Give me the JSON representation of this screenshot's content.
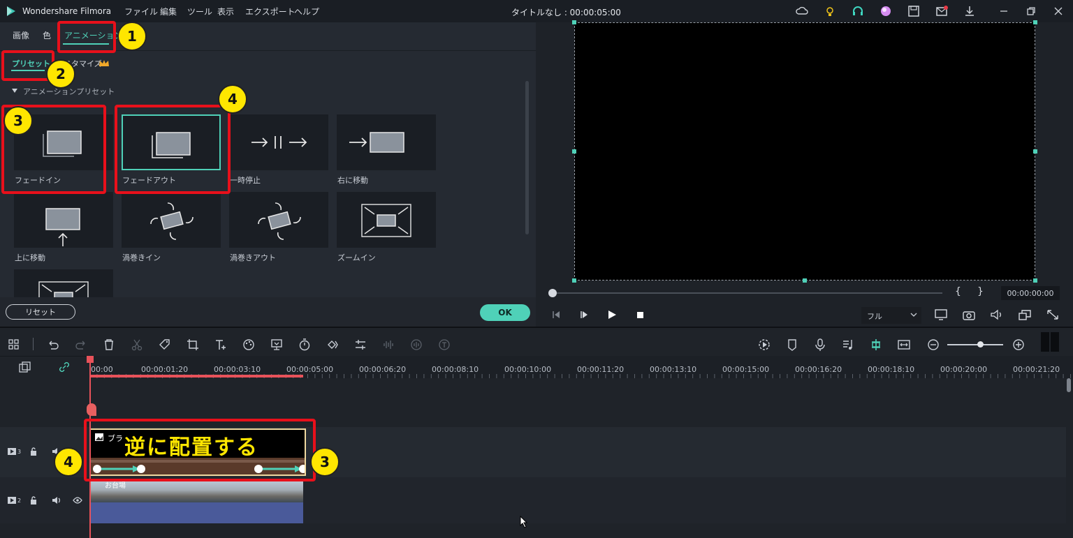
{
  "app": {
    "name": "Wondershare Filmora",
    "window_title": "タイトルなし : 00:00:05:00"
  },
  "menu": [
    "ファイル",
    "編集",
    "ツール",
    "表示",
    "エクスポート",
    "ヘルプ"
  ],
  "panel": {
    "tabs": [
      "画像",
      "色",
      "アニメーション"
    ],
    "subtabs": [
      "プリセット",
      "カスタマイズ"
    ],
    "section_title": "アニメーションプリセット",
    "presets": [
      {
        "label": "フェードイン"
      },
      {
        "label": "フェードアウト"
      },
      {
        "label": "一時停止"
      },
      {
        "label": "右に移動"
      },
      {
        "label": "上に移動"
      },
      {
        "label": "渦巻きイン"
      },
      {
        "label": "渦巻きアウト"
      },
      {
        "label": "ズームイン"
      }
    ],
    "reset_label": "リセット",
    "ok_label": "OK"
  },
  "preview": {
    "timecode": "00:00:00:00",
    "quality": "フル",
    "bracket_in": "{",
    "bracket_out": "}"
  },
  "timeline": {
    "ruler": [
      "00:00",
      "00:00:01:20",
      "00:00:03:10",
      "00:00:05:00",
      "00:00:06:20",
      "00:00:08:10",
      "00:00:10:00",
      "00:00:11:20",
      "00:00:13:10",
      "00:00:15:00",
      "00:00:16:20",
      "00:00:18:10",
      "00:00:20:00",
      "00:00:21:20"
    ],
    "tracks": [
      {
        "num": "3"
      },
      {
        "num": "2"
      }
    ],
    "clip_top_title": "ブラ",
    "clip_bottom_title": "お台場"
  },
  "annotation": {
    "overlay_text": "逆に配置する",
    "badges": [
      "1",
      "2",
      "3",
      "4",
      "4",
      "3"
    ]
  },
  "colors": {
    "accent": "#4fd1b8",
    "annotation_red": "#e8101b",
    "badge_yellow": "#ffe600",
    "overlay_text": "#ffe600"
  }
}
